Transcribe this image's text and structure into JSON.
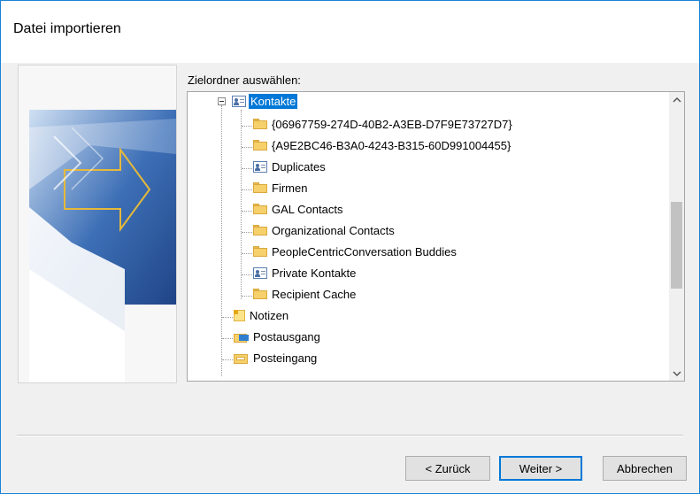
{
  "window": {
    "title": "Datei importieren"
  },
  "tree": {
    "label": "Zielordner auswählen:",
    "items": [
      {
        "label": "Kontakte",
        "icon": "contact-icon",
        "selected": true
      },
      {
        "label": "{06967759-274D-40B2-A3EB-D7F9E73727D7}",
        "icon": "folder-icon"
      },
      {
        "label": "{A9E2BC46-B3A0-4243-B315-60D991004455}",
        "icon": "folder-icon"
      },
      {
        "label": "Duplicates",
        "icon": "contact-icon"
      },
      {
        "label": "Firmen",
        "icon": "folder-icon"
      },
      {
        "label": "GAL Contacts",
        "icon": "folder-icon"
      },
      {
        "label": "Organizational Contacts",
        "icon": "folder-icon"
      },
      {
        "label": "PeopleCentricConversation Buddies",
        "icon": "folder-icon"
      },
      {
        "label": "Private Kontakte",
        "icon": "contact-icon"
      },
      {
        "label": "Recipient Cache",
        "icon": "folder-icon"
      },
      {
        "label": "Notizen",
        "icon": "note-icon"
      },
      {
        "label": "Postausgang",
        "icon": "outbox-icon"
      },
      {
        "label": "Posteingang",
        "icon": "inbox-icon"
      }
    ]
  },
  "buttons": {
    "back": "< Zurück",
    "next": "Weiter >",
    "cancel": "Abbrechen"
  },
  "colors": {
    "accent": "#0078d7",
    "window_border": "#1883d7",
    "dialog_bg": "#f0f0f0",
    "folder": "#f6d06b"
  }
}
